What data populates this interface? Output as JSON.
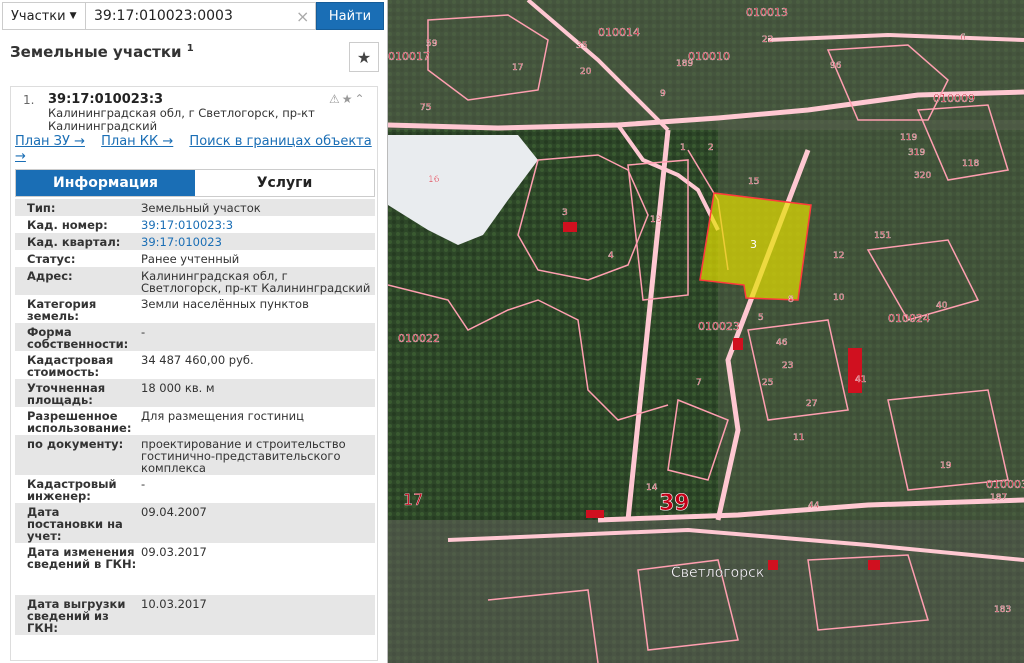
{
  "search": {
    "type_label": "Участки",
    "query": "39:17:010023:0003",
    "find_label": "Найти"
  },
  "section": {
    "title": "Земельные участки",
    "count": "1"
  },
  "card": {
    "index": "1.",
    "cad_number": "39:17:010023:3",
    "address": "Калининградская обл, г Светлогорск, пр-кт Калининградский",
    "links": [
      "План ЗУ →",
      "План КК →",
      "Поиск в границах объекта →"
    ],
    "tabs": [
      "Информация",
      "Услуги"
    ]
  },
  "info": [
    {
      "label": "Тип:",
      "value": "Земельный участок",
      "h": 1
    },
    {
      "label": "Кад. номер:",
      "value": "39:17:010023:3",
      "link": true,
      "h": 1
    },
    {
      "label": "Кад. квартал:",
      "value": "39:17:010023",
      "link": true,
      "h": 1
    },
    {
      "label": "Статус:",
      "value": "Ранее учтенный",
      "h": 1
    },
    {
      "label": "Адрес:",
      "value": "Калининградская обл, г Светлогорск, пр-кт Калининградский",
      "h": 2
    },
    {
      "label": "Категория земель:",
      "value": "Земли населённых пунктов",
      "h": 2
    },
    {
      "label": "Форма собственности:",
      "value": "-",
      "h": 2
    },
    {
      "label": "Кадастровая стоимость:",
      "value": "34 487 460,00 руб.",
      "h": 2
    },
    {
      "label": "Уточненная площадь:",
      "value": "18 000 кв. м",
      "h": 2
    },
    {
      "label": "Разрешенное использование:",
      "value": "Для размещения гостиниц",
      "h": 2
    },
    {
      "label": "по документу:",
      "value": "проектирование и строительство гостинично-представительского комплекса",
      "h": 3
    },
    {
      "label": "Кадастровый инженер:",
      "value": "-",
      "h": 2
    },
    {
      "label": "Дата постановки на учет:",
      "value": "09.04.2007",
      "h": 3
    },
    {
      "label": "Дата изменения сведений в ГКН:",
      "value": "09.03.2017",
      "h": 4
    },
    {
      "label": "Дата выгрузки сведений из ГКН:",
      "value": "10.03.2017",
      "h": 3
    }
  ],
  "map": {
    "colors": {
      "parcel_line": "#ff9fb0",
      "label": "#c40018",
      "selected": "#e6e000",
      "forest": "#2c4426"
    },
    "city_label": "Светлогорск",
    "district_label": "39",
    "block_labels": [
      "010014",
      "010010",
      "010013",
      "010017",
      "010009",
      "010022",
      "010023",
      "010024",
      "010003",
      "17"
    ],
    "parcel_labels": [
      "59",
      "35",
      "20",
      "17",
      "9",
      "22",
      "96",
      "189",
      "6",
      "75",
      "1",
      "2",
      "3",
      "13",
      "15",
      "16",
      "4",
      "8",
      "5",
      "7",
      "14",
      "151",
      "40",
      "46",
      "23",
      "25",
      "27",
      "11",
      "10",
      "12",
      "41",
      "44",
      "19",
      "187",
      "183",
      "119",
      "118",
      "319",
      "320"
    ],
    "selected_label": "3"
  }
}
